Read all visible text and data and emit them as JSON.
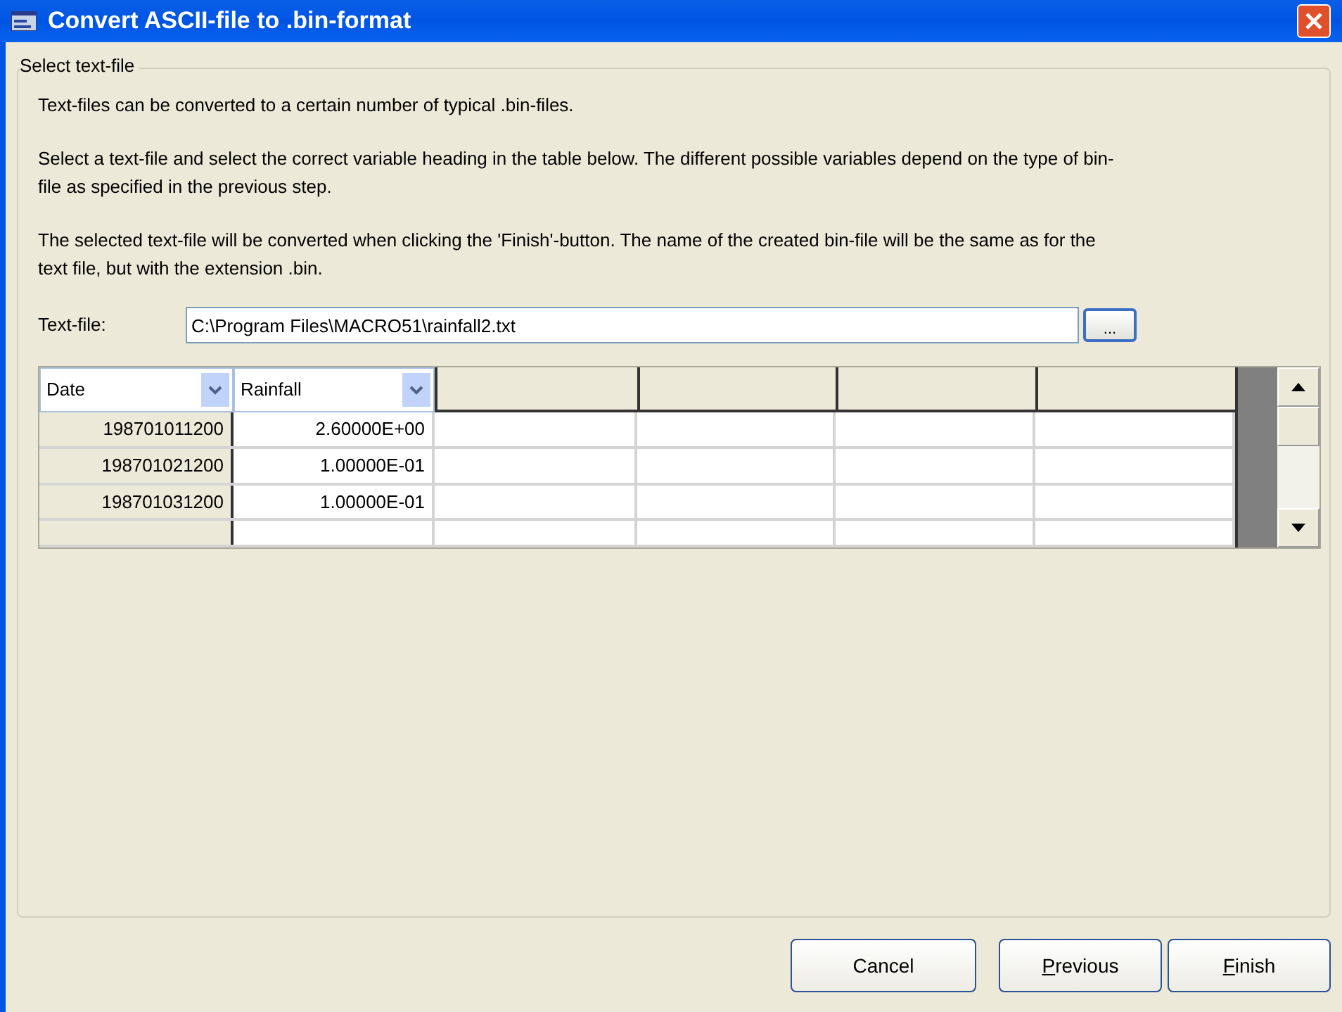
{
  "window": {
    "title": "Convert ASCII-file to .bin-format"
  },
  "group": {
    "title": "Select text-file"
  },
  "paragraphs": [
    "Text-files can be converted to a certain number of typical .bin-files.",
    "Select a text-file and select the correct variable heading in the table below. The different possible variables depend on the type of bin-file as specified in the previous step.",
    "The selected text-file will be converted when clicking the 'Finish'-button. The name of the created bin-file will be the same as for the text file, but with the extension .bin."
  ],
  "text_file": {
    "label": "Text-file:",
    "value": "C:\\Program Files\\MACRO51\\rainfall2.txt",
    "browse": "..."
  },
  "table": {
    "columns": [
      {
        "kind": "dropdown",
        "label": "Date"
      },
      {
        "kind": "dropdown",
        "label": "Rainfall"
      },
      {
        "kind": "blank"
      },
      {
        "kind": "blank"
      },
      {
        "kind": "blank"
      },
      {
        "kind": "blank"
      }
    ],
    "rows": [
      [
        "198701011200",
        "2.60000E+00"
      ],
      [
        "198701021200",
        "1.00000E-01"
      ],
      [
        "198701031200",
        "1.00000E-01"
      ]
    ]
  },
  "buttons": [
    {
      "label": "Cancel",
      "accelerator_underlined": false
    },
    {
      "label": "Previous",
      "accelerator_underlined": true
    },
    {
      "label": "Finish",
      "accelerator_underlined": true
    }
  ]
}
